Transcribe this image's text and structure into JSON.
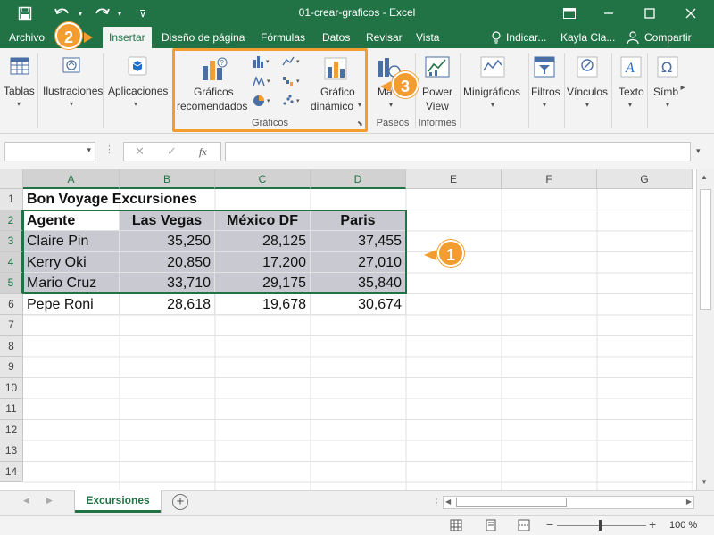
{
  "title_bar": {
    "title": "01-crear-graficos  -  Excel",
    "icons": [
      "save-icon",
      "undo-icon",
      "redo-icon",
      "customize-icon"
    ]
  },
  "tabs": [
    {
      "label": "Archivo"
    },
    {
      "label": "Insertar",
      "active": true
    },
    {
      "label": "Diseño de página"
    },
    {
      "label": "Fórmulas"
    },
    {
      "label": "Datos"
    },
    {
      "label": "Revisar"
    },
    {
      "label": "Vista"
    }
  ],
  "tell_me": "Indicar...",
  "user": "Kayla Cla...",
  "share": "Compartir",
  "ribbon": {
    "tablas": "Tablas",
    "ilustraciones": "Ilustraciones",
    "aplicaciones": "Aplicaciones",
    "graficos_rec_1": "Gráficos",
    "graficos_rec_2": "recomendados",
    "grafico_din_1": "Gráfico",
    "grafico_din_2": "dinámico",
    "graficos_group": "Gráficos",
    "mapas": "Ma",
    "paseos": "Paseos",
    "power_view_1": "Power",
    "power_view_2": "View",
    "informes": "Informes",
    "minigraficos": "Minigráficos",
    "filtros": "Filtros",
    "vinculos": "Vínculos",
    "texto": "Texto",
    "simbolos": "Símb"
  },
  "formula_bar": {
    "name_box": "",
    "fx": "fx",
    "formula": ""
  },
  "columns": [
    "A",
    "B",
    "C",
    "D",
    "E",
    "F",
    "G"
  ],
  "rows": [
    "1",
    "2",
    "3",
    "4",
    "5",
    "6",
    "7",
    "8",
    "9",
    "10",
    "11",
    "12",
    "13",
    "14"
  ],
  "sheet": {
    "title": "Bon Voyage Excursiones",
    "headers": [
      "Agente",
      "Las Vegas",
      "México DF",
      "Paris"
    ],
    "data": [
      [
        "Claire Pin",
        "35,250",
        "28,125",
        "37,455"
      ],
      [
        "Kerry Oki",
        "20,850",
        "17,200",
        "27,010"
      ],
      [
        "Mario Cruz",
        "33,710",
        "29,175",
        "35,840"
      ],
      [
        "Pepe Roni",
        "28,618",
        "19,678",
        "30,674"
      ]
    ]
  },
  "sheet_tab": "Excursiones",
  "zoom": "100 %",
  "callouts": [
    "1",
    "2",
    "3"
  ],
  "colors": {
    "brand": "#217346",
    "callout": "#f39c30",
    "selection": "#c9c9d2"
  }
}
